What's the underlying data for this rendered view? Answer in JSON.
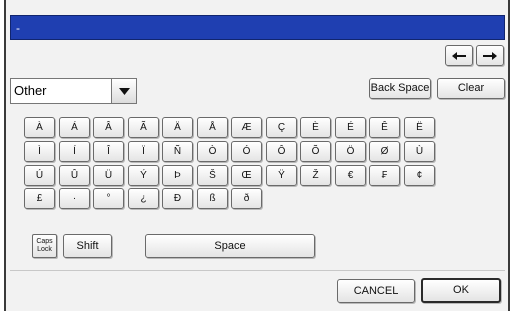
{
  "title": "-",
  "category_select": {
    "value": "Other"
  },
  "buttons": {
    "back_space": "Back Space",
    "clear": "Clear",
    "caps_lock_line1": "Caps",
    "caps_lock_line2": "Lock",
    "shift": "Shift",
    "space": "Space",
    "cancel": "CANCEL",
    "ok": "OK"
  },
  "keys": [
    [
      "À",
      "Á",
      "Â",
      "Ã",
      "Ä",
      "Å",
      "Æ",
      "Ç",
      "È",
      "É",
      "Ê",
      "Ë"
    ],
    [
      "Ì",
      "Í",
      "Î",
      "Ï",
      "Ñ",
      "Ò",
      "Ó",
      "Ô",
      "Õ",
      "Ö",
      "Ø",
      "Ù"
    ],
    [
      "Ú",
      "Û",
      "Ü",
      "Ý",
      "Þ",
      "Š",
      "Œ",
      "Ÿ",
      "Ž",
      "€",
      "₣",
      "¢"
    ],
    [
      "£",
      "·",
      "°",
      "¿",
      "Đ",
      "ß",
      "ð"
    ]
  ],
  "colors": {
    "titlebar": "#1f3fb1",
    "panel": "#f2f2f2"
  }
}
